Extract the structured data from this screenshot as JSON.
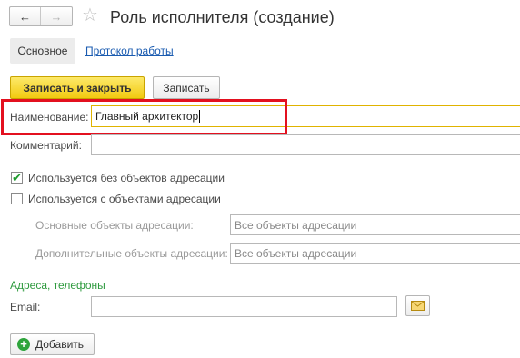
{
  "header": {
    "back_icon": "←",
    "forward_icon": "→",
    "star_icon": "☆",
    "title": "Роль исполнителя (создание)"
  },
  "tabs": [
    {
      "label": "Основное",
      "active": true
    },
    {
      "label": "Протокол работы",
      "active": false
    }
  ],
  "toolbar": {
    "save_close_label": "Записать и закрыть",
    "save_label": "Записать"
  },
  "form": {
    "name_label": "Наименование:",
    "name_value": "Главный архитектор",
    "comment_label": "Комментарий:",
    "comment_value": "",
    "checkbox_no_objects": {
      "label": "Используется без объектов адресации",
      "checked": true
    },
    "checkbox_with_objects": {
      "label": "Используется с объектами адресации",
      "checked": false
    },
    "main_objects_label": "Основные объекты адресации:",
    "main_objects_value": "Все объекты адресации",
    "extra_objects_label": "Дополнительные объекты адресации:",
    "extra_objects_value": "Все объекты адресации"
  },
  "contacts": {
    "section_title": "Адреса, телефоны",
    "email_label": "Email:",
    "email_value": "",
    "add_label": "Добавить",
    "plus_icon": "+"
  },
  "colors": {
    "accent_yellow": "#f2ca10",
    "highlight_red": "#e3101f",
    "section_green": "#2e9a3e",
    "link_blue": "#1a5bb0"
  }
}
